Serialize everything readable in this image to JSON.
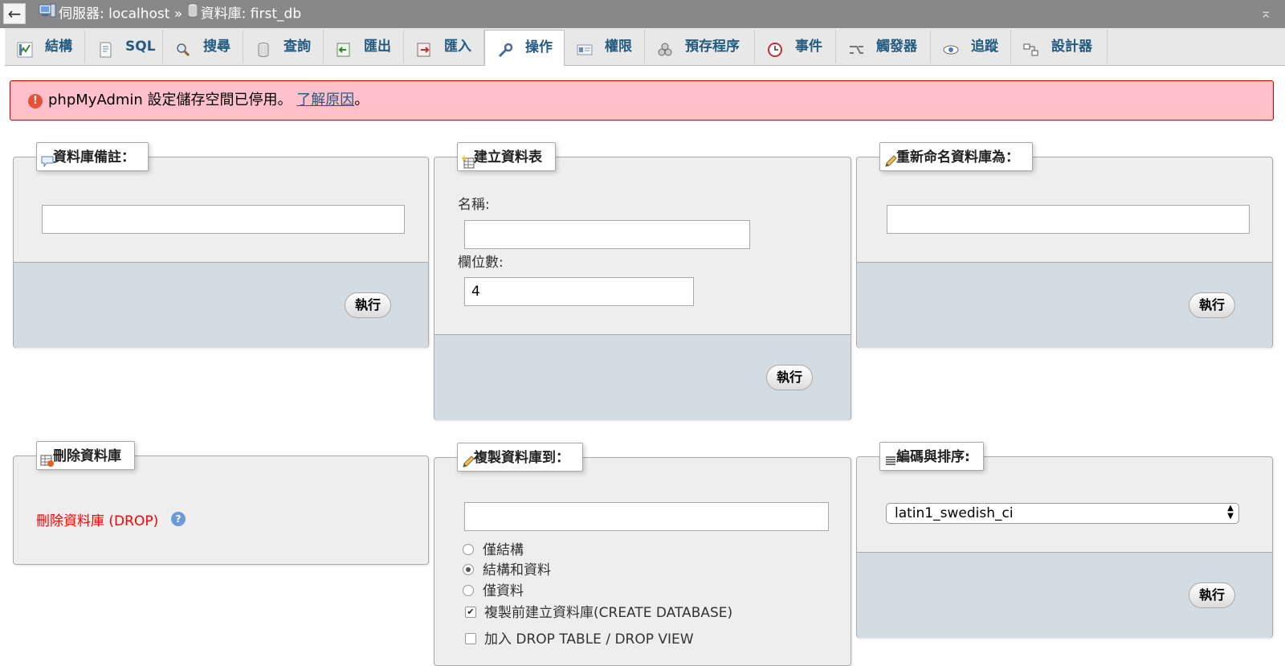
{
  "topbar": {
    "back_label": "←",
    "server_label": "伺服器: localhost",
    "separator": "»",
    "db_label": "資料庫: first_db",
    "collapse_label": "⌅"
  },
  "tabs": [
    {
      "label": "結構",
      "icon": "structure-icon"
    },
    {
      "label": "SQL",
      "icon": "sql-icon"
    },
    {
      "label": "搜尋",
      "icon": "search-icon"
    },
    {
      "label": "查詢",
      "icon": "query-icon"
    },
    {
      "label": "匯出",
      "icon": "export-icon"
    },
    {
      "label": "匯入",
      "icon": "import-icon"
    },
    {
      "label": "操作",
      "icon": "wrench-icon",
      "active": true
    },
    {
      "label": "權限",
      "icon": "privileges-icon"
    },
    {
      "label": "預存程序",
      "icon": "routines-icon"
    },
    {
      "label": "事件",
      "icon": "clock-icon"
    },
    {
      "label": "觸發器",
      "icon": "triggers-icon"
    },
    {
      "label": "追蹤",
      "icon": "eye-icon"
    },
    {
      "label": "設計器",
      "icon": "designer-icon"
    }
  ],
  "banner": {
    "message": "phpMyAdmin 設定儲存空間已停用。",
    "link": "了解原因",
    "suffix": "。"
  },
  "db_comment": {
    "legend": "資料庫備註：",
    "value": "",
    "go_label": "執行"
  },
  "create_table": {
    "legend": "建立資料表",
    "name_label": "名稱:",
    "name_value": "",
    "columns_label": "欄位數:",
    "columns_value": "4",
    "go_label": "執行"
  },
  "rename_db": {
    "legend": "重新命名資料庫為：",
    "value": "",
    "go_label": "執行"
  },
  "drop_db": {
    "legend": "刪除資料庫",
    "link": "刪除資料庫 (DROP)",
    "help_label": "?"
  },
  "copy_db": {
    "legend": "複製資料庫到：",
    "value": "",
    "options": [
      "僅結構",
      "結構和資料",
      "僅資料"
    ],
    "selected_option": "結構和資料",
    "check_create": "複製前建立資料庫(CREATE DATABASE)",
    "check_create_checked": true,
    "check_drop": "加入 DROP TABLE / DROP VIEW",
    "check_drop_checked": false
  },
  "collation": {
    "legend": "編碼與排序:",
    "selected": "latin1_swedish_ci",
    "go_label": "執行"
  },
  "colors": {
    "link": "#235a81",
    "error_bg": "#ffc0cb",
    "drop_red": "#ff0000",
    "footer_bg": "#d3dce3"
  }
}
